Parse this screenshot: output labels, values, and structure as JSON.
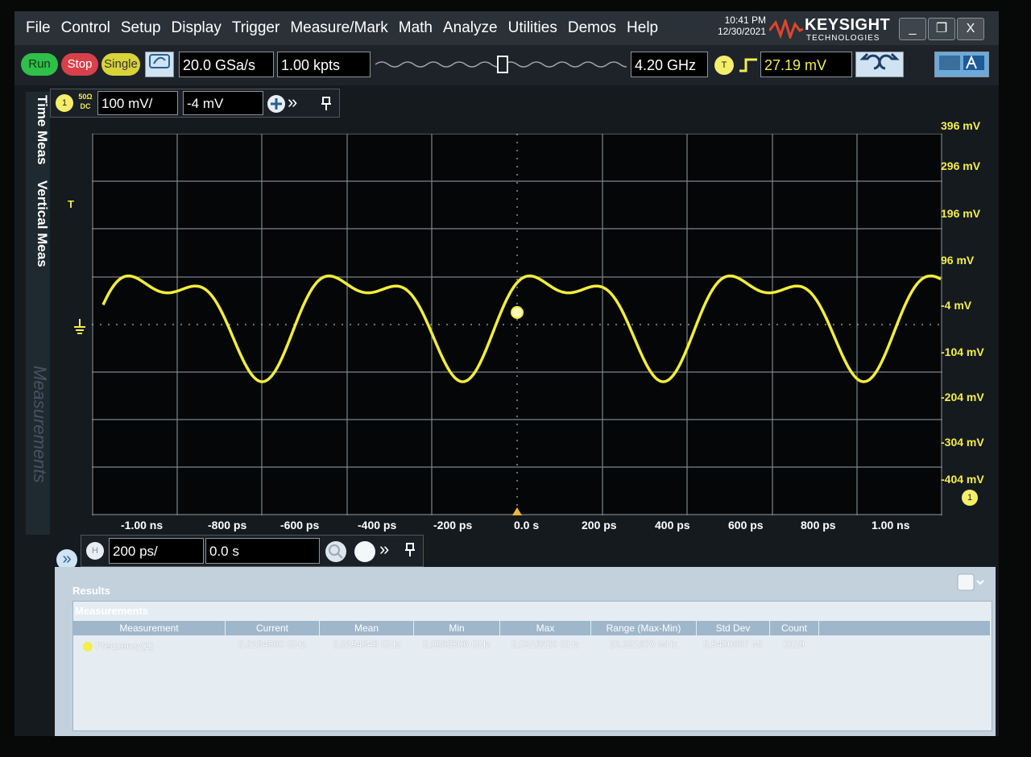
{
  "menu": [
    "File",
    "Control",
    "Setup",
    "Display",
    "Trigger",
    "Measure/Mark",
    "Math",
    "Analyze",
    "Utilities",
    "Demos",
    "Help"
  ],
  "clock": {
    "time": "10:41 PM",
    "date": "12/30/2021"
  },
  "brand": {
    "name": "KEYSIGHT",
    "sub": "TECHNOLOGIES"
  },
  "window_buttons": {
    "minimize": "_",
    "restore": "❐",
    "close": "X"
  },
  "toolbar": {
    "run": "Run",
    "stop": "Stop",
    "single": "Single",
    "sample_rate": "20.0 GSa/s",
    "memory_depth": "1.00 kpts",
    "bandwidth": "4.20 GHz",
    "trigger_badge": "T",
    "trigger_level": "27.19 mV"
  },
  "side_tabs": {
    "time_meas": "Time Meas",
    "vertical_meas": "Vertical Meas",
    "measurements": "Measurements"
  },
  "channel": {
    "number": "1",
    "coupling_top": "50Ω",
    "coupling_bottom": "DC",
    "scale": "100 mV/",
    "offset": "-4 mV"
  },
  "graticule": {
    "y_labels": [
      "396 mV",
      "296 mV",
      "196 mV",
      "96 mV",
      "-4 mV",
      "-104 mV",
      "-204 mV",
      "-304 mV",
      "-404 mV"
    ],
    "x_labels": [
      "-1.00 ns",
      "-800 ps",
      "-600 ps",
      "-400 ps",
      "-200 ps",
      "0.0 s",
      "200 ps",
      "400 ps",
      "600 ps",
      "800 ps",
      "1.00 ns"
    ],
    "marker_trigger": "T",
    "trace_color": "#f2ee3a"
  },
  "timebase": {
    "badge": "H",
    "scale": "200 ps/",
    "position": "0.0 s"
  },
  "results": {
    "title": "Results",
    "subtitle": "Measurements",
    "columns": [
      "Measurement",
      "Current",
      "Mean",
      "Min",
      "Max",
      "Range (Max-Min)",
      "Std Dev",
      "Count"
    ],
    "rows": [
      {
        "name": "Frequency(1)",
        "current": "2.0184660 GHz",
        "mean": "2.0194348 GHz",
        "min": "2.0083306 GHz",
        "max": "2.0316525 GHz",
        "range": "23.321870 MHz",
        "std": "3.5400837 MI",
        "count": "3119"
      }
    ]
  }
}
